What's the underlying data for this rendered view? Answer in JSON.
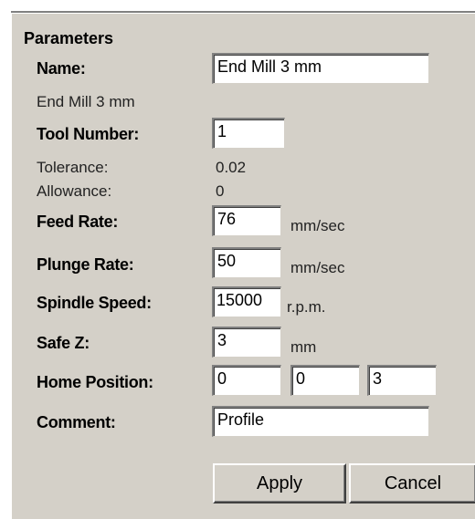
{
  "section": {
    "title": "Parameters"
  },
  "name": {
    "label": "Name:",
    "value": "End Mill 3 mm",
    "display": "End Mill 3 mm"
  },
  "tool_number": {
    "label": "Tool Number:",
    "value": "1"
  },
  "tolerance": {
    "label": "Tolerance:",
    "value": "0.02"
  },
  "allowance": {
    "label": "Allowance:",
    "value": "0"
  },
  "feed_rate": {
    "label": "Feed Rate:",
    "value": "76",
    "unit": "mm/sec"
  },
  "plunge_rate": {
    "label": "Plunge Rate:",
    "value": "50",
    "unit": "mm/sec"
  },
  "spindle_speed": {
    "label": "Spindle Speed:",
    "value": "15000",
    "unit": "r.p.m."
  },
  "safe_z": {
    "label": "Safe Z:",
    "value": "3",
    "unit": "mm"
  },
  "home_position": {
    "label": "Home Position:",
    "x": "0",
    "y": "0",
    "z": "3"
  },
  "comment": {
    "label": "Comment:",
    "value": "Profile"
  },
  "buttons": {
    "apply": "Apply",
    "cancel": "Cancel"
  },
  "colors": {
    "panel_bg": "#d4d0c8",
    "field_bg": "#ffffff",
    "shadow": "#808080"
  }
}
